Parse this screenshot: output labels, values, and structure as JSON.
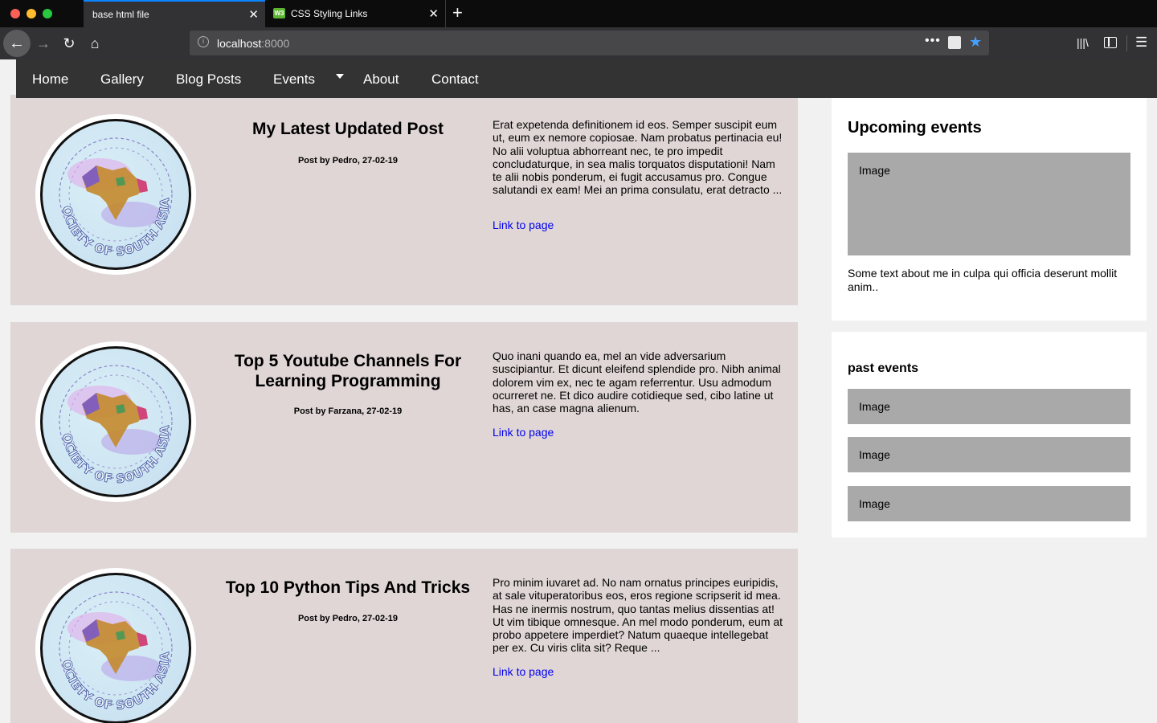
{
  "browser": {
    "tabs": [
      {
        "title": "base html file",
        "active": true
      },
      {
        "title": "CSS Styling Links",
        "active": false
      }
    ],
    "url_host": "localhost",
    "url_port": ":8000",
    "favicon_text": "W3"
  },
  "site_nav": {
    "items": [
      "Home",
      "Gallery",
      "Blog Posts",
      "Events",
      "About",
      "Contact"
    ]
  },
  "posts": [
    {
      "title": "My Latest Updated Post",
      "meta": "Post by Pedro, 27-02-19",
      "excerpt": "Erat expetenda definitionem id eos. Semper suscipit eum ut, eum ex nemore copiosae. Nam probatus pertinacia eu! No alii voluptua abhorreant nec, te pro impedit concludaturque, in sea malis torquatos disputationi! Nam te alii nobis ponderum, ei fugit accusamus pro. Congue salutandi ex eam! Mei an prima consulatu, erat detracto ...",
      "link": "Link to page",
      "logo_text": "SOCIETY OF SOUTH ASIA"
    },
    {
      "title": "Top 5 Youtube Channels For Learning Programming",
      "meta": "Post by Farzana, 27-02-19",
      "excerpt": "Quo inani quando ea, mel an vide adversarium suscipiantur. Et dicunt eleifend splendide pro. Nibh animal dolorem vim ex, nec te agam referrentur. Usu admodum ocurreret ne. Et dico audire cotidieque sed, cibo latine ut has, an case magna alienum.",
      "link": "Link to page",
      "logo_text": "SOCIETY OF SOUTH ASIA"
    },
    {
      "title": "Top 10 Python Tips And Tricks",
      "meta": "Post by Pedro, 27-02-19",
      "excerpt": "Pro minim iuvaret ad. No nam ornatus principes euripidis, at sale vituperatoribus eos, eros regione scripserit id mea. Has ne inermis nostrum, quo tantas melius dissentias at! Ut vim tibique omnesque. An mel modo ponderum, eum at probo appetere imperdiet? Natum quaeque intellegebat per ex. Cu viris clita sit? Reque ...",
      "link": "Link to page",
      "logo_text": "SOCIETY OF SOUTH ASIA"
    }
  ],
  "sidebar": {
    "upcoming": {
      "title": "Upcoming events",
      "image_label": "Image",
      "text": "Some text about me in culpa qui officia deserunt mollit anim.."
    },
    "past": {
      "title": "past events",
      "images": [
        "Image",
        "Image",
        "Image"
      ]
    }
  }
}
